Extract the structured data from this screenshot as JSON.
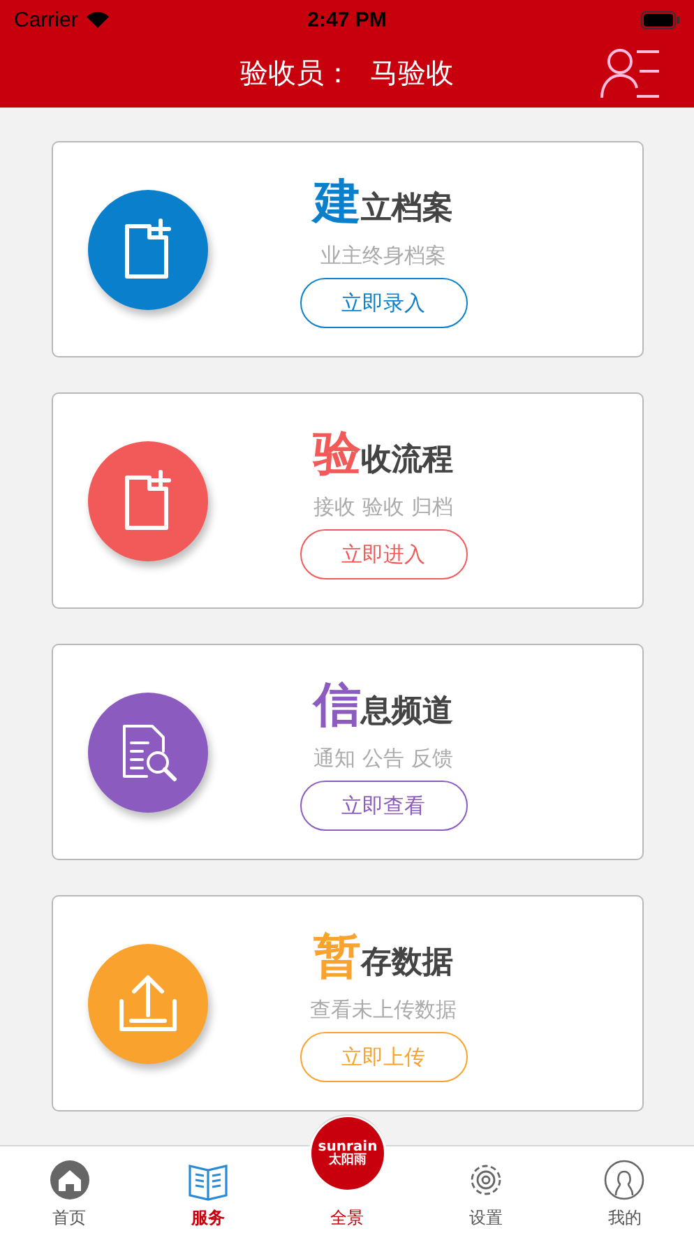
{
  "status_bar": {
    "carrier": "Carrier",
    "time": "2:47 PM"
  },
  "header": {
    "title": "验收员：  马验收"
  },
  "cards": [
    {
      "title_lead": "建",
      "title_rest": "立档案",
      "subtitle": "业主终身档案",
      "button": "立即录入",
      "color": "#0a80cc",
      "kind": "file-plus"
    },
    {
      "title_lead": "验",
      "title_rest": "收流程",
      "subtitle": "接收 验收 归档",
      "button": "立即进入",
      "color": "#f25a5a",
      "kind": "file-plus"
    },
    {
      "title_lead": "信",
      "title_rest": "息频道",
      "subtitle": "通知 公告 反馈",
      "button": "立即查看",
      "color": "#8c5bbf",
      "kind": "doc-search"
    },
    {
      "title_lead": "暂",
      "title_rest": "存数据",
      "subtitle": "查看未上传数据",
      "button": "立即上传",
      "color": "#f9a32e",
      "kind": "upload"
    }
  ],
  "tabs": [
    {
      "label": "首页",
      "kind": "home",
      "selected": false
    },
    {
      "label": "服务",
      "kind": "book",
      "selected": true
    },
    {
      "label": "全景",
      "kind": "logo",
      "selected": false,
      "logo_text": [
        "sunrain",
        "太阳雨"
      ]
    },
    {
      "label": "设置",
      "kind": "gear",
      "selected": false
    },
    {
      "label": "我的",
      "kind": "person",
      "selected": false
    }
  ]
}
